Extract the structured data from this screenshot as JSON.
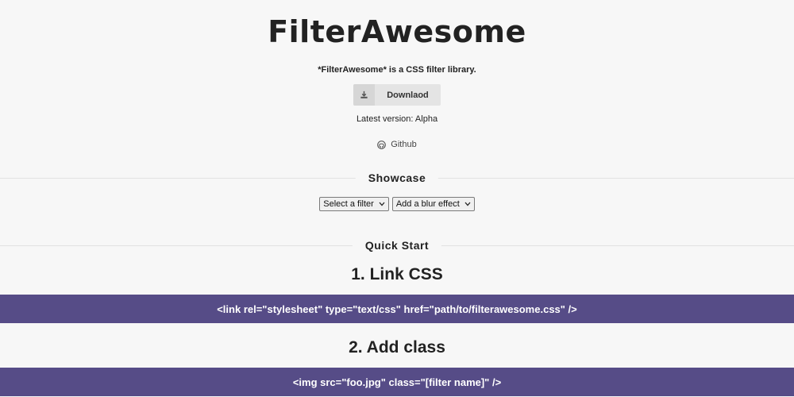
{
  "header": {
    "title": "FilterAwesome",
    "tagline": "*FilterAwesome* is a CSS filter library.",
    "download_label": "Downlaod",
    "download_icon": "download-icon",
    "version_text": "Latest version: Alpha",
    "github_label": "Github",
    "github_icon": "github-icon"
  },
  "showcase": {
    "heading": "Showcase",
    "filter_select": {
      "selected": "Select a filter"
    },
    "blur_select": {
      "selected": "Add a blur effect"
    }
  },
  "quick_start": {
    "heading": "Quick Start",
    "step1_title": "1. Link CSS",
    "step1_code": "<link rel=\"stylesheet\" type=\"text/css\" href=\"path/to/filterawesome.css\" />",
    "step2_title": "2. Add class",
    "step2_code": "<img src=\"foo.jpg\" class=\"[filter name]\" />"
  },
  "colors": {
    "background": "#f7f7f7",
    "code_bar": "#564c87",
    "button": "#e4e4e4"
  }
}
